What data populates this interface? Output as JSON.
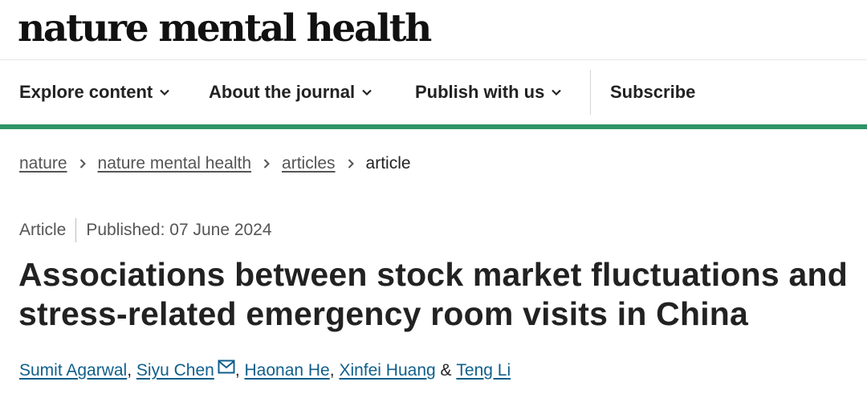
{
  "masthead": {
    "brand": "nature mental health"
  },
  "nav": {
    "items": [
      {
        "label": "Explore content",
        "dropdown": true
      },
      {
        "label": "About the journal",
        "dropdown": true
      },
      {
        "label": "Publish with us",
        "dropdown": true
      },
      {
        "label": "Subscribe",
        "dropdown": false
      }
    ],
    "accent_color": "#2e9467"
  },
  "breadcrumb": {
    "items": [
      "nature",
      "nature mental health",
      "articles"
    ],
    "current": "article"
  },
  "article": {
    "type": "Article",
    "published": "Published: 07 June 2024",
    "title": "Associations between stock market fluctuations and stress-related emergency room visits in China",
    "authors": [
      "Sumit Agarwal",
      "Siyu Chen",
      "Haonan He",
      "Xinfei Huang",
      "Teng Li"
    ],
    "author_separator": ",",
    "last_separator": "&",
    "corresponding_icon": "mail-icon",
    "link_color": "#0f5f8c"
  }
}
